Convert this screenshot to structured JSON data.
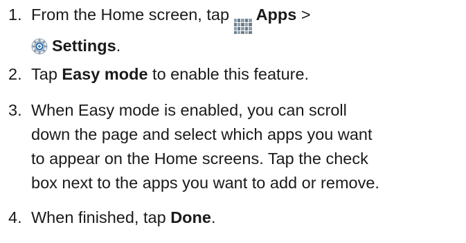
{
  "steps": [
    {
      "number": "1.",
      "parts": {
        "t1": "From the Home screen, tap ",
        "apps_icon": "apps-grid-icon",
        "apps_label": "Apps",
        "sep": " > ",
        "settings_icon": "gear-icon",
        "settings_label": "Settings",
        "end": "."
      }
    },
    {
      "number": "2.",
      "parts": {
        "t1": "Tap ",
        "bold": "Easy mode",
        "t2": " to enable this feature."
      }
    },
    {
      "number": "3.",
      "parts": {
        "line1": "When Easy mode is enabled, you can scroll",
        "line2": "down the page and select which apps you want",
        "line3": "to appear on the Home screens. Tap the check",
        "line4": "box next to the apps you want to add or remove."
      }
    },
    {
      "number": "4.",
      "parts": {
        "t1": "When finished, tap ",
        "bold": "Done",
        "end": "."
      }
    }
  ],
  "colors": {
    "text": "#1a1a1a",
    "apps_icon": "#6b7d8a",
    "settings_icon_ring": "#2a6fb0"
  }
}
